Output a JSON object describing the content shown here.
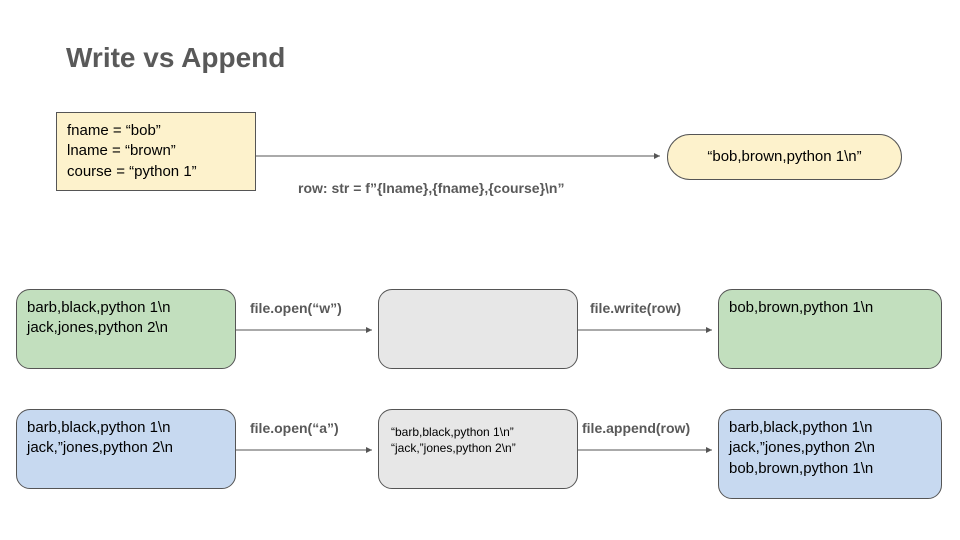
{
  "title": "Write vs Append",
  "vars_box": "fname = “bob”\nlname = “brown”\ncourse = “python 1”",
  "row_expr": "row: str = f”{lname},{fname},{course}\\n”",
  "row_result": "“bob,brown,python 1\\n”",
  "write_flow": {
    "before": "barb,black,python 1\\n\njack,jones,python 2\\n",
    "open_label": "file.open(“w”)",
    "middle": "",
    "write_label": "file.write(row)",
    "after": "bob,brown,python 1\\n"
  },
  "append_flow": {
    "before": "barb,black,python 1\\n\njack,”jones,python 2\\n",
    "open_label": "file.open(“a”)",
    "middle": "“barb,black,python 1\\n”\n“jack,”jones,python 2\\n”",
    "write_label": "file.append(row)",
    "after": "barb,black,python 1\\n\njack,”jones,python 2\\n\nbob,brown,python 1\\n"
  }
}
